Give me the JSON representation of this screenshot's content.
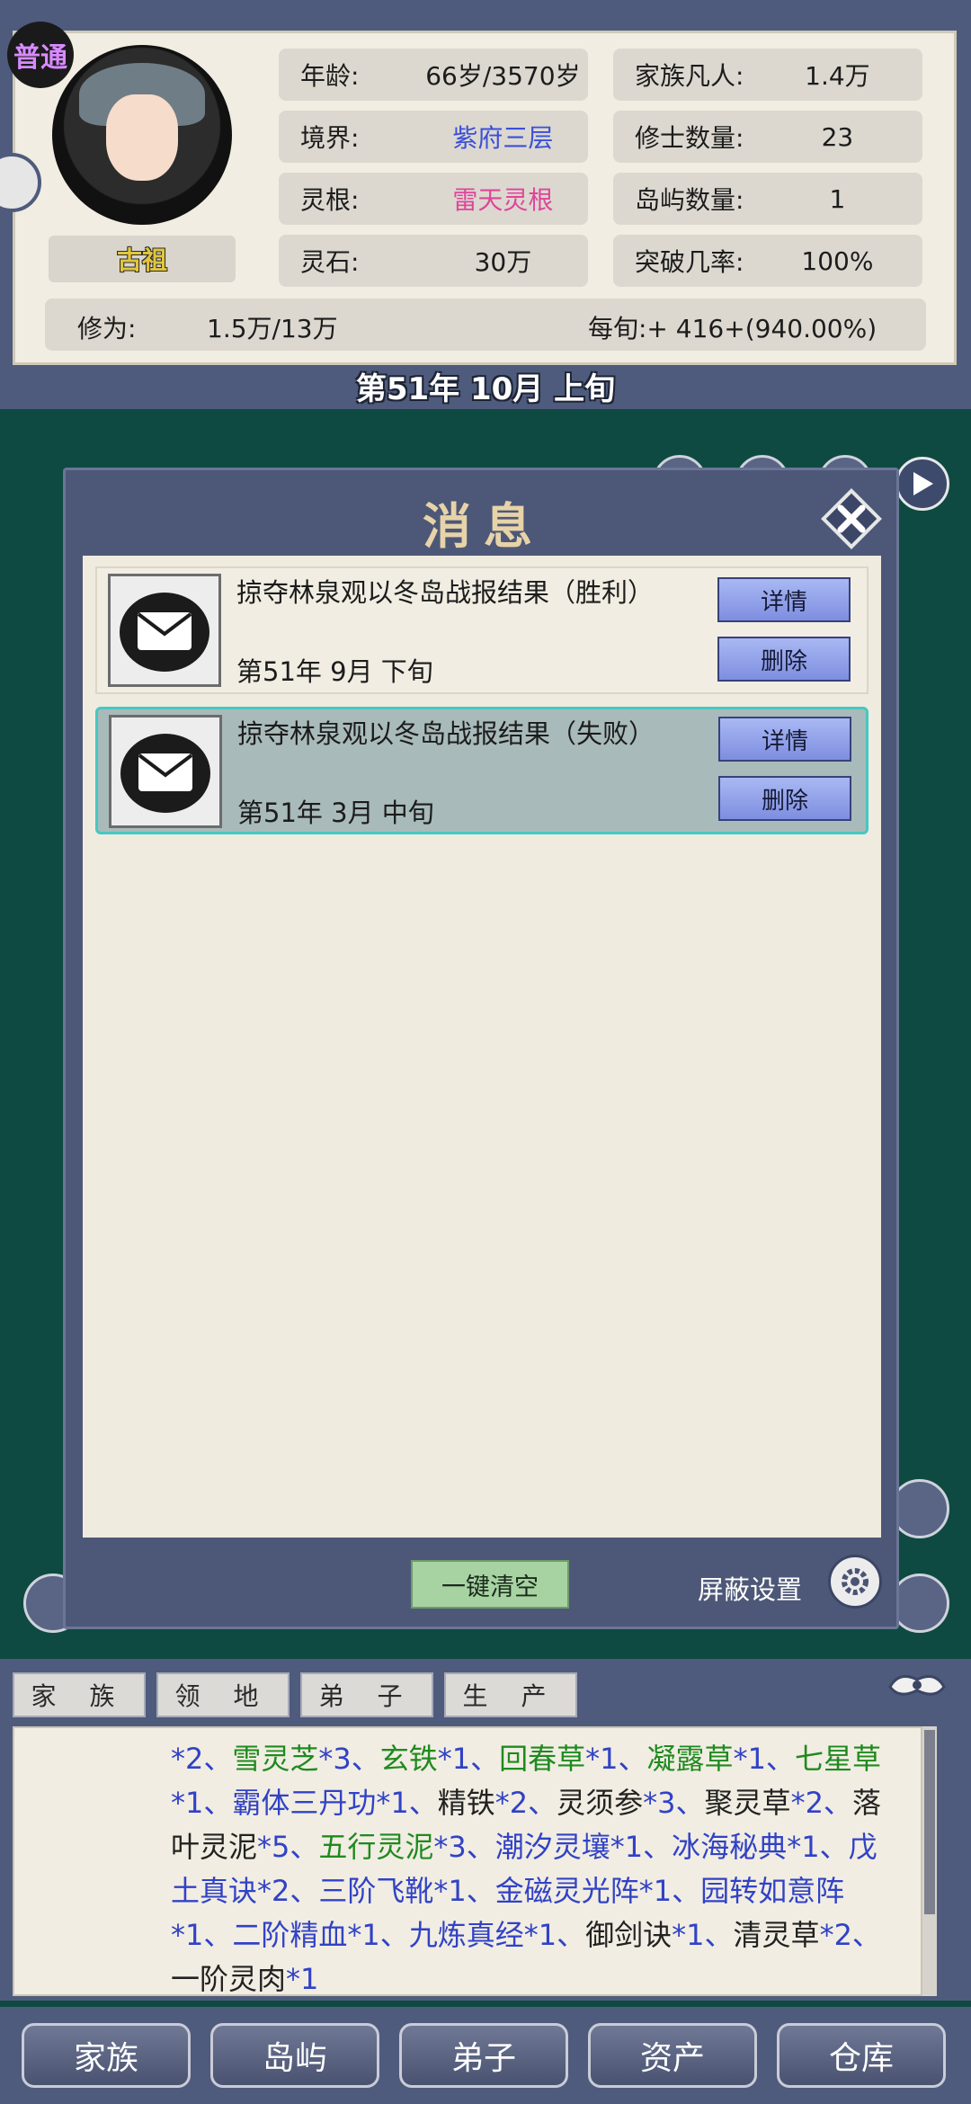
{
  "header": {
    "rank_badge": "普通",
    "title_label": "古祖",
    "stats_left": [
      {
        "key": "年龄:",
        "value": "66岁/3570岁",
        "color": ""
      },
      {
        "key": "境界:",
        "value": "紫府三层",
        "color": "blue"
      },
      {
        "key": "灵根:",
        "value": "雷天灵根",
        "color": "pink"
      },
      {
        "key": "灵石:",
        "value": "30万",
        "color": ""
      }
    ],
    "stats_right": [
      {
        "key": "家族凡人:",
        "value": "1.4万"
      },
      {
        "key": "修士数量:",
        "value": "23"
      },
      {
        "key": "岛屿数量:",
        "value": "1"
      },
      {
        "key": "突破几率:",
        "value": "100%"
      }
    ],
    "cultivation_label": "修为:",
    "cultivation_value": "1.5万/13万",
    "per_period": "每旬:+ 416+(940.00%)",
    "date": "第51年 10月 上旬"
  },
  "dialog": {
    "title": "消息",
    "messages": [
      {
        "title": "掠夺林泉观以冬岛战报结果（胜利）",
        "date": "第51年 9月 下旬",
        "detail_label": "详情",
        "delete_label": "删除",
        "selected": false
      },
      {
        "title": "掠夺林泉观以冬岛战报结果（失败）",
        "date": "第51年 3月 中旬",
        "detail_label": "详情",
        "delete_label": "删除",
        "selected": true
      }
    ],
    "clear_all_label": "一键清空",
    "shield_settings_label": "屏蔽设置"
  },
  "lower_tabs": [
    "家 族",
    "领 地",
    "弟 子",
    "生 产"
  ],
  "log": {
    "segments": [
      {
        "t": "*2、",
        "c": "b"
      },
      {
        "t": "雪灵芝",
        "c": "g"
      },
      {
        "t": "*3、",
        "c": "b"
      },
      {
        "t": "玄铁",
        "c": "g"
      },
      {
        "t": "*1、",
        "c": "b"
      },
      {
        "t": "回春草",
        "c": "g"
      },
      {
        "t": "*1、",
        "c": "b"
      },
      {
        "t": "凝露草",
        "c": "g"
      },
      {
        "t": "*1、",
        "c": "b"
      },
      {
        "t": "七星草",
        "c": "g"
      },
      {
        "t": "*1、",
        "c": "b"
      },
      {
        "t": "霸体三丹功",
        "c": "b"
      },
      {
        "t": "*1、",
        "c": "b"
      },
      {
        "t": "精铁",
        "c": ""
      },
      {
        "t": "*2、",
        "c": "b"
      },
      {
        "t": "灵须参",
        "c": ""
      },
      {
        "t": "*3、",
        "c": "b"
      },
      {
        "t": "聚灵草",
        "c": ""
      },
      {
        "t": "*2、",
        "c": "b"
      },
      {
        "t": "落叶灵泥",
        "c": ""
      },
      {
        "t": "*5、",
        "c": "b"
      },
      {
        "t": "五行灵泥",
        "c": "g"
      },
      {
        "t": "*3、",
        "c": "b"
      },
      {
        "t": "潮汐灵壤",
        "c": "b"
      },
      {
        "t": "*1、",
        "c": "b"
      },
      {
        "t": "冰海秘典",
        "c": "b"
      },
      {
        "t": "*1、",
        "c": "b"
      },
      {
        "t": "戊土真诀",
        "c": "b"
      },
      {
        "t": "*2、",
        "c": "b"
      },
      {
        "t": "三阶飞靴",
        "c": "b"
      },
      {
        "t": "*1、",
        "c": "b"
      },
      {
        "t": "金磁灵光阵",
        "c": "b"
      },
      {
        "t": "*1、",
        "c": "b"
      },
      {
        "t": "园转如意阵",
        "c": "b"
      },
      {
        "t": "*1、",
        "c": "b"
      },
      {
        "t": "二阶精血",
        "c": "b"
      },
      {
        "t": "*1、",
        "c": "b"
      },
      {
        "t": "九炼真经",
        "c": "b"
      },
      {
        "t": "*1、",
        "c": "b"
      },
      {
        "t": "御剑诀",
        "c": ""
      },
      {
        "t": "*1、",
        "c": "b"
      },
      {
        "t": "清灵草",
        "c": ""
      },
      {
        "t": "*2、",
        "c": "b"
      },
      {
        "t": "一阶灵肉",
        "c": ""
      },
      {
        "t": "*1",
        "c": "b"
      }
    ]
  },
  "bottom_nav": [
    "家族",
    "岛屿",
    "弟子",
    "资产",
    "仓库"
  ],
  "colors": {
    "panel": "#4f5b7c",
    "paper": "#f1ede2",
    "button_blue": "#7e8ee0",
    "selected_border": "#45c8c2",
    "log_green": "#1f8a1f",
    "log_blue": "#3142c6"
  }
}
